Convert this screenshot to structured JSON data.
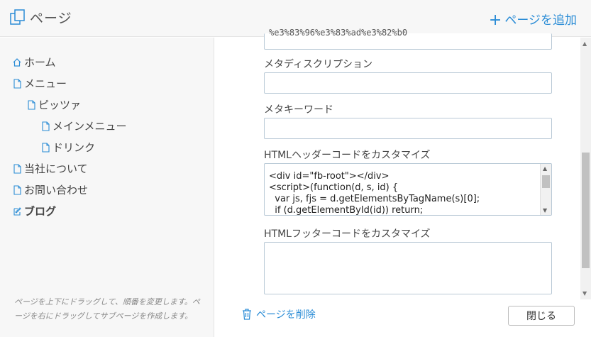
{
  "header": {
    "title": "ページ",
    "add_label": "ページを追加",
    "accent": "#2a8cd6"
  },
  "sidebar": {
    "items": [
      {
        "label": "ホーム",
        "icon": "home-icon"
      },
      {
        "label": "メニュー",
        "icon": "page-icon"
      },
      {
        "label": "ピッツァ",
        "icon": "page-icon"
      },
      {
        "label": "メインメニュー",
        "icon": "page-icon"
      },
      {
        "label": "ドリンク",
        "icon": "page-icon"
      },
      {
        "label": "当社について",
        "icon": "page-icon"
      },
      {
        "label": "お問い合わせ",
        "icon": "page-icon"
      },
      {
        "label": "ブログ",
        "icon": "edit-icon"
      }
    ],
    "hint": "ページを上下にドラッグして、順番を変更します。ページを右にドラッグしてサブページを作成します。"
  },
  "form": {
    "url_value": "%e3%83%96%e3%83%ad%e3%82%b0",
    "meta_description_label": "メタディスクリプション",
    "meta_description_value": "",
    "meta_keywords_label": "メタキーワード",
    "meta_keywords_value": "",
    "header_code_label": "HTMLヘッダーコードをカスタマイズ",
    "header_code_value": "<div id=\"fb-root\"></div>\n<script>(function(d, s, id) {\n  var js, fjs = d.getElementsByTagName(s)[0];\n  if (d.getElementById(id)) return;",
    "footer_code_label": "HTMLフッターコードをカスタマイズ",
    "footer_code_value": ""
  },
  "actions": {
    "delete_label": "ページを削除",
    "close_label": "閉じる"
  }
}
